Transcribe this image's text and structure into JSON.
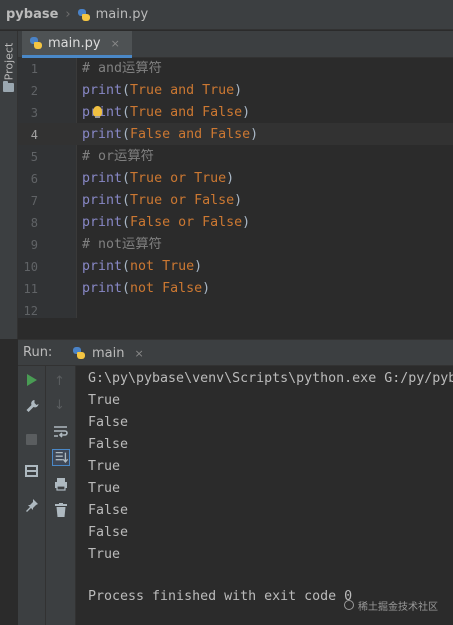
{
  "nav": {
    "project": "pybase",
    "separator": "›",
    "file": "main.py"
  },
  "left_strip": {
    "label": "Project"
  },
  "tabs": [
    {
      "label": "main.py",
      "close": "×"
    }
  ],
  "editor": {
    "current_line": 4,
    "lines": [
      {
        "n": "1",
        "tokens": [
          {
            "t": "# and运算符",
            "c": "cm"
          }
        ]
      },
      {
        "n": "2",
        "tokens": [
          {
            "t": "print",
            "c": "fn"
          },
          {
            "t": "(",
            "c": ""
          },
          {
            "t": "True",
            "c": "kw"
          },
          {
            "t": " ",
            "c": ""
          },
          {
            "t": "and",
            "c": "kw"
          },
          {
            "t": " ",
            "c": ""
          },
          {
            "t": "True",
            "c": "kw"
          },
          {
            "t": ")",
            "c": ""
          }
        ]
      },
      {
        "n": "3",
        "tokens": [
          {
            "t": "print",
            "c": "fn"
          },
          {
            "t": "(",
            "c": ""
          },
          {
            "t": "True",
            "c": "kw"
          },
          {
            "t": " ",
            "c": ""
          },
          {
            "t": "and",
            "c": "kw"
          },
          {
            "t": " ",
            "c": ""
          },
          {
            "t": "False",
            "c": "kw"
          },
          {
            "t": ")",
            "c": ""
          }
        ]
      },
      {
        "n": "4",
        "tokens": [
          {
            "t": "print",
            "c": "fn"
          },
          {
            "t": "(",
            "c": ""
          },
          {
            "t": "False",
            "c": "kw"
          },
          {
            "t": " ",
            "c": ""
          },
          {
            "t": "and",
            "c": "kw"
          },
          {
            "t": " ",
            "c": ""
          },
          {
            "t": "False",
            "c": "kw"
          },
          {
            "t": ")",
            "c": ""
          }
        ]
      },
      {
        "n": "5",
        "tokens": [
          {
            "t": "# or运算符",
            "c": "cm"
          }
        ]
      },
      {
        "n": "6",
        "tokens": [
          {
            "t": "print",
            "c": "fn"
          },
          {
            "t": "(",
            "c": ""
          },
          {
            "t": "True",
            "c": "kw"
          },
          {
            "t": " ",
            "c": ""
          },
          {
            "t": "or",
            "c": "kw"
          },
          {
            "t": " ",
            "c": ""
          },
          {
            "t": "True",
            "c": "kw"
          },
          {
            "t": ")",
            "c": ""
          }
        ]
      },
      {
        "n": "7",
        "tokens": [
          {
            "t": "print",
            "c": "fn"
          },
          {
            "t": "(",
            "c": ""
          },
          {
            "t": "True",
            "c": "kw"
          },
          {
            "t": " ",
            "c": ""
          },
          {
            "t": "or",
            "c": "kw"
          },
          {
            "t": " ",
            "c": ""
          },
          {
            "t": "False",
            "c": "kw"
          },
          {
            "t": ")",
            "c": ""
          }
        ]
      },
      {
        "n": "8",
        "tokens": [
          {
            "t": "print",
            "c": "fn"
          },
          {
            "t": "(",
            "c": ""
          },
          {
            "t": "False",
            "c": "kw"
          },
          {
            "t": " ",
            "c": ""
          },
          {
            "t": "or",
            "c": "kw"
          },
          {
            "t": " ",
            "c": ""
          },
          {
            "t": "False",
            "c": "kw"
          },
          {
            "t": ")",
            "c": ""
          }
        ]
      },
      {
        "n": "9",
        "tokens": [
          {
            "t": "# not运算符",
            "c": "cm"
          }
        ]
      },
      {
        "n": "10",
        "tokens": [
          {
            "t": "print",
            "c": "fn"
          },
          {
            "t": "(",
            "c": ""
          },
          {
            "t": "not",
            "c": "kw"
          },
          {
            "t": " ",
            "c": ""
          },
          {
            "t": "True",
            "c": "kw"
          },
          {
            "t": ")",
            "c": ""
          }
        ]
      },
      {
        "n": "11",
        "tokens": [
          {
            "t": "print",
            "c": "fn"
          },
          {
            "t": "(",
            "c": ""
          },
          {
            "t": "not",
            "c": "kw"
          },
          {
            "t": " ",
            "c": ""
          },
          {
            "t": "False",
            "c": "kw"
          },
          {
            "t": ")",
            "c": ""
          }
        ]
      },
      {
        "n": "12",
        "tokens": []
      }
    ]
  },
  "run": {
    "title": "Run:",
    "tab": "main",
    "close": "×",
    "command": "G:\\py\\pybase\\venv\\Scripts\\python.exe G:/py/pyb",
    "output": [
      "True",
      "False",
      "False",
      "True",
      "True",
      "False",
      "False",
      "True"
    ],
    "exit": "Process finished with exit code 0"
  },
  "watermark": "稀土掘金技术社区",
  "colors": {
    "keyword": "#cc7832",
    "builtin": "#8888c6",
    "comment": "#808080",
    "text": "#a9b7c6",
    "run_green": "#499c54",
    "tab_underline": "#4a88c7"
  }
}
